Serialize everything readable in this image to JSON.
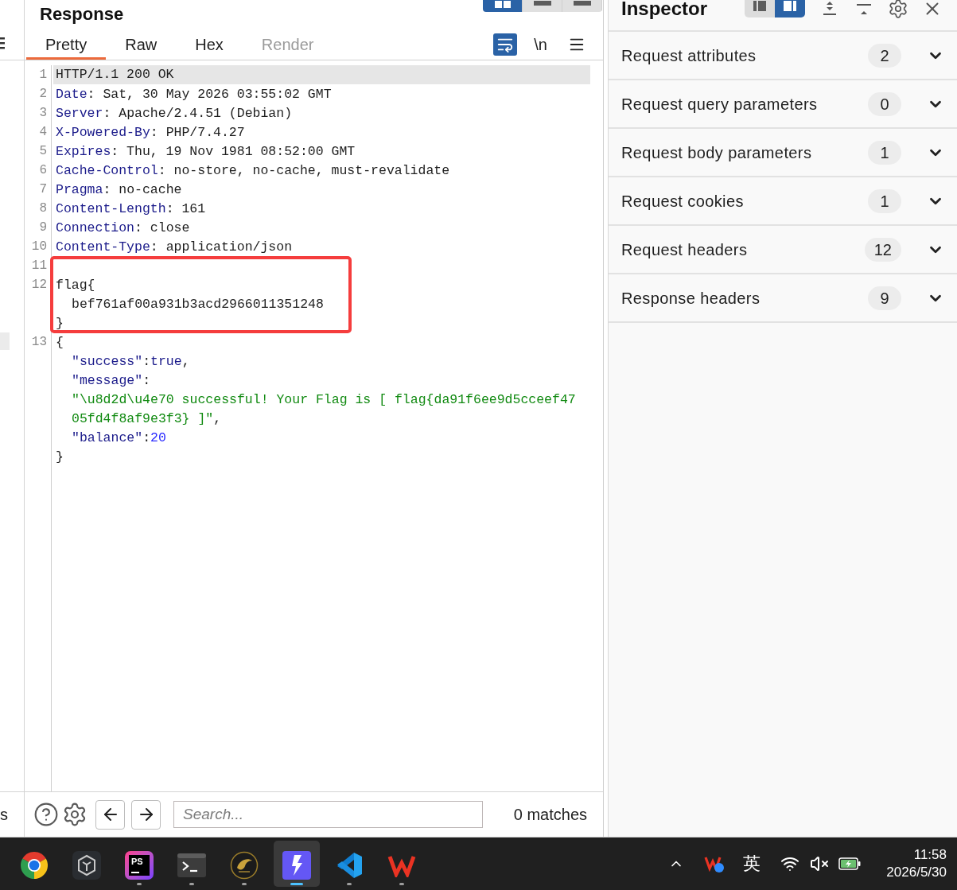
{
  "left_panel": {
    "text_fragment": "s"
  },
  "response": {
    "title": "Response",
    "layout_buttons": [
      {
        "kind": "columns",
        "selected": true
      },
      {
        "kind": "bar",
        "selected": false
      },
      {
        "kind": "bar",
        "selected": false
      }
    ],
    "tabs": [
      {
        "label": "Pretty",
        "selected": true,
        "disabled": false
      },
      {
        "label": "Raw",
        "selected": false,
        "disabled": false
      },
      {
        "label": "Hex",
        "selected": false,
        "disabled": false
      },
      {
        "label": "Render",
        "selected": false,
        "disabled": true
      }
    ],
    "toolbar": {
      "wrap_on": true,
      "newline_label": "\\n"
    },
    "lines": [
      {
        "number": "1",
        "highlighted": true,
        "rows": [
          {
            "tokens": [
              {
                "kind": "plain",
                "text": "HTTP/1.1 200 OK"
              }
            ]
          }
        ]
      },
      {
        "number": "2",
        "highlighted": false,
        "rows": [
          {
            "tokens": [
              {
                "kind": "name",
                "text": "Date"
              },
              {
                "kind": "plain",
                "text": ": Sat, 30 May 2026 03:55:02 GMT"
              }
            ]
          }
        ]
      },
      {
        "number": "3",
        "highlighted": false,
        "rows": [
          {
            "tokens": [
              {
                "kind": "name",
                "text": "Server"
              },
              {
                "kind": "plain",
                "text": ": Apache/2.4.51 (Debian)"
              }
            ]
          }
        ]
      },
      {
        "number": "4",
        "highlighted": false,
        "rows": [
          {
            "tokens": [
              {
                "kind": "name",
                "text": "X-Powered-By"
              },
              {
                "kind": "plain",
                "text": ": PHP/7.4.27"
              }
            ]
          }
        ]
      },
      {
        "number": "5",
        "highlighted": false,
        "rows": [
          {
            "tokens": [
              {
                "kind": "name",
                "text": "Expires"
              },
              {
                "kind": "plain",
                "text": ": Thu, 19 Nov 1981 08:52:00 GMT"
              }
            ]
          }
        ]
      },
      {
        "number": "6",
        "highlighted": false,
        "rows": [
          {
            "tokens": [
              {
                "kind": "name",
                "text": "Cache-Control"
              },
              {
                "kind": "plain",
                "text": ": no-store, no-cache, must-revalidate"
              }
            ]
          }
        ]
      },
      {
        "number": "7",
        "highlighted": false,
        "rows": [
          {
            "tokens": [
              {
                "kind": "name",
                "text": "Pragma"
              },
              {
                "kind": "plain",
                "text": ": no-cache"
              }
            ]
          }
        ]
      },
      {
        "number": "8",
        "highlighted": false,
        "rows": [
          {
            "tokens": [
              {
                "kind": "name",
                "text": "Content-Length"
              },
              {
                "kind": "plain",
                "text": ": 161"
              }
            ]
          }
        ]
      },
      {
        "number": "9",
        "highlighted": false,
        "rows": [
          {
            "tokens": [
              {
                "kind": "name",
                "text": "Connection"
              },
              {
                "kind": "plain",
                "text": ": close"
              }
            ]
          }
        ]
      },
      {
        "number": "10",
        "highlighted": false,
        "rows": [
          {
            "tokens": [
              {
                "kind": "name",
                "text": "Content-Type"
              },
              {
                "kind": "plain",
                "text": ": application/json"
              }
            ]
          }
        ]
      },
      {
        "number": "11",
        "highlighted": false
      },
      {
        "number": "12",
        "highlighted": false,
        "rows": [
          {
            "tokens": [
              {
                "kind": "plain",
                "text": "flag{"
              }
            ],
            "children": [
              {
                "tokens": [
                  {
                    "kind": "plain",
                    "text": "bef761af00a931b3acd2966011351248"
                  }
                ]
              }
            ]
          },
          {
            "tokens": [
              {
                "kind": "plain",
                "text": "}"
              }
            ]
          }
        ]
      },
      {
        "number": "13",
        "highlighted": false,
        "rows": [
          {
            "tokens": [
              {
                "kind": "plain",
                "text": "{"
              }
            ],
            "children": [
              {
                "tokens": [
                  {
                    "kind": "name",
                    "text": "\"success\""
                  },
                  {
                    "kind": "plain",
                    "text": ":"
                  },
                  {
                    "kind": "literal",
                    "text": "true"
                  },
                  {
                    "kind": "plain",
                    "text": ","
                  }
                ]
              },
              {
                "tokens": [
                  {
                    "kind": "name",
                    "text": "\"message\""
                  },
                  {
                    "kind": "plain",
                    "text": ":"
                  }
                ]
              },
              {
                "tokens": [
                  {
                    "kind": "string",
                    "text": "\"\\u8d2d\\u4e70 successful! Your Flag is [ flag{da91f6ee9d5cceef47"
                  }
                ]
              },
              {
                "tokens": [
                  {
                    "kind": "string",
                    "text": "05fd4f8af9e3f3} ]\""
                  },
                  {
                    "kind": "plain",
                    "text": ","
                  }
                ]
              },
              {
                "tokens": [
                  {
                    "kind": "name",
                    "text": "\"balance\""
                  },
                  {
                    "kind": "plain",
                    "text": ":"
                  },
                  {
                    "kind": "number",
                    "text": "20"
                  }
                ]
              }
            ]
          },
          {
            "tokens": [
              {
                "kind": "plain",
                "text": "}"
              }
            ]
          }
        ]
      }
    ],
    "search": {
      "placeholder": "Search...",
      "matches": "0 matches"
    }
  },
  "inspector": {
    "title": "Inspector",
    "layout_buttons": [
      {
        "kind": "left",
        "selected": false
      },
      {
        "kind": "right",
        "selected": true
      }
    ],
    "sections": [
      {
        "label": "Request attributes",
        "count": "2",
        "expanded": false
      },
      {
        "label": "Request query parameters",
        "count": "0",
        "expanded": false
      },
      {
        "label": "Request body parameters",
        "count": "1",
        "expanded": false
      },
      {
        "label": "Request cookies",
        "count": "1",
        "expanded": false
      },
      {
        "label": "Request headers",
        "count": "12",
        "expanded": false
      },
      {
        "label": "Response headers",
        "count": "9",
        "expanded": false
      }
    ]
  },
  "taskbar": {
    "apps": [
      {
        "kind": "browser",
        "running": false,
        "selected": false
      },
      {
        "kind": "cube",
        "running": false,
        "selected": false
      },
      {
        "kind": "ps",
        "label": "PS",
        "running": true,
        "selected": false
      },
      {
        "kind": "terminal",
        "running": true,
        "selected": false
      },
      {
        "kind": "emblem",
        "running": true,
        "selected": false
      },
      {
        "kind": "bolt",
        "running": true,
        "selected": true
      },
      {
        "kind": "ribbon",
        "running": true,
        "selected": false
      },
      {
        "kind": "zigzag",
        "running": true,
        "selected": false
      }
    ],
    "input_method": "英",
    "time": "11:58",
    "date": "2026/5/30"
  }
}
